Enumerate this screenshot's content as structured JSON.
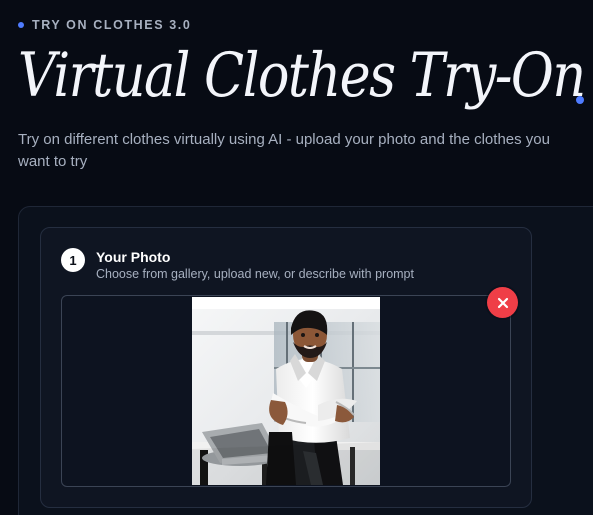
{
  "header": {
    "eyebrow": "TRY ON CLOTHES 3.0",
    "title": "Virtual Clothes Try-On",
    "subtitle": "Try on different clothes virtually using AI - upload your photo and the clothes you want to try"
  },
  "step": {
    "number": "1",
    "title": "Your Photo",
    "description": "Choose from gallery, upload new, or describe with prompt"
  },
  "icons": {
    "remove": "close-icon"
  },
  "colors": {
    "background": "#070b14",
    "accent": "#4f7cff",
    "danger": "#ef3e47"
  }
}
